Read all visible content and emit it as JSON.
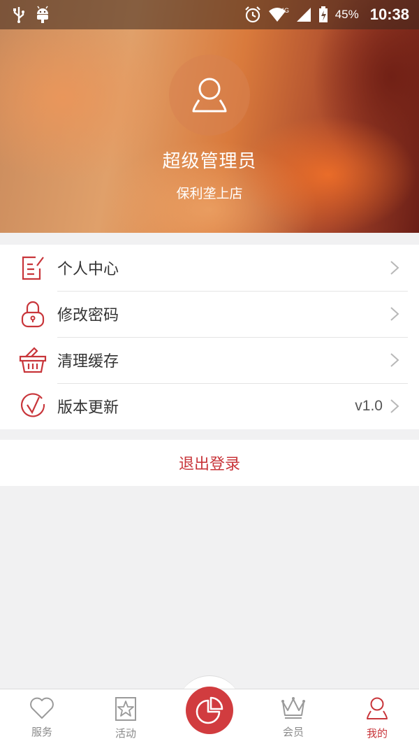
{
  "status_bar": {
    "battery": "45%",
    "time": "10:38",
    "network": "4G",
    "icons": [
      "usb-icon",
      "android-icon",
      "alarm-icon",
      "wifi-icon",
      "signal-icon",
      "battery-icon"
    ]
  },
  "profile": {
    "name": "超级管理员",
    "store": "保利垄上店",
    "avatar_icon": "user-icon"
  },
  "menu": {
    "items": [
      {
        "label": "个人中心",
        "icon": "edit-document-icon",
        "value": ""
      },
      {
        "label": "修改密码",
        "icon": "lock-icon",
        "value": ""
      },
      {
        "label": "清理缓存",
        "icon": "basket-icon",
        "value": ""
      },
      {
        "label": "版本更新",
        "icon": "check-circle-icon",
        "value": "v1.0"
      }
    ]
  },
  "logout_label": "退出登录",
  "tabbar": {
    "tabs": [
      {
        "label": "服务",
        "icon": "heart-icon"
      },
      {
        "label": "活动",
        "icon": "star-icon"
      },
      {
        "label": "会员",
        "icon": "crown-icon"
      },
      {
        "label": "我的",
        "icon": "user-icon"
      }
    ],
    "center_icon": "pie-chart-icon"
  },
  "colors": {
    "accent": "#c8353a",
    "inactive": "#8a8a8a",
    "background": "#f1f1f2"
  }
}
